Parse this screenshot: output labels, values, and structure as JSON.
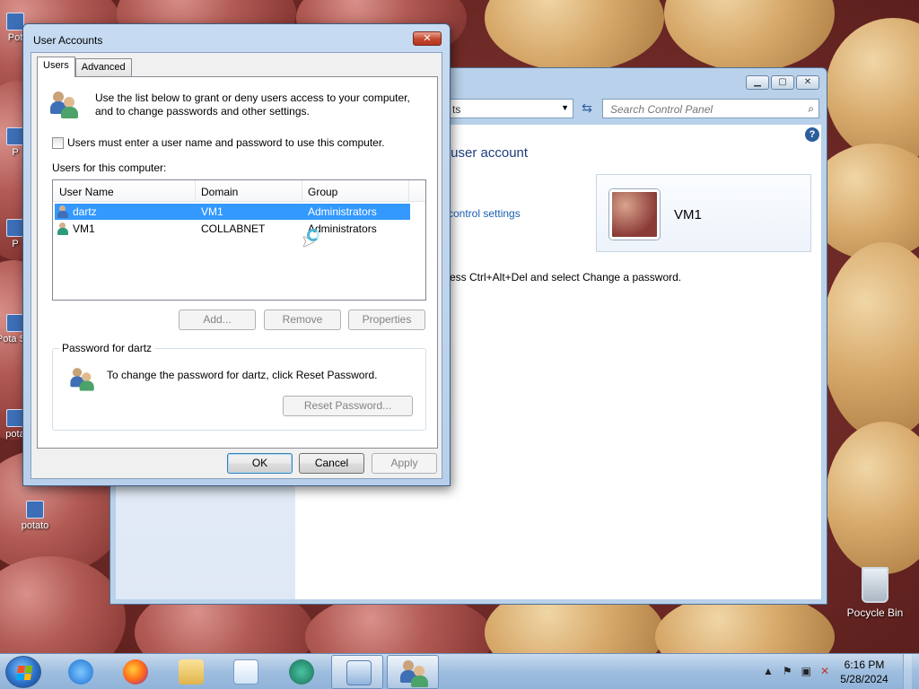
{
  "desktop": {
    "icons": [
      {
        "label": "Pot"
      },
      {
        "label": "P"
      },
      {
        "label": "P"
      },
      {
        "label": "Pota Stu"
      },
      {
        "label": "pota"
      },
      {
        "label": "potato"
      }
    ],
    "recycle_bin_label": "Pocycle Bin"
  },
  "control_panel": {
    "address_text": "ts",
    "search_placeholder": "Search Control Panel",
    "heading": "r user account",
    "link_text": "control settings",
    "instruction_text": "ress Ctrl+Alt+Del and select Change a password.",
    "user_name": "VM1",
    "help_label": "?"
  },
  "dialog": {
    "title": "User Accounts",
    "close_label": "✕",
    "tabs": [
      {
        "label": "Users",
        "active": true
      },
      {
        "label": "Advanced",
        "active": false
      }
    ],
    "intro": "Use the list below to grant or deny users access to your computer, and to change passwords and other settings.",
    "must_logon_label": "Users must enter a user name and password to use this computer.",
    "must_logon_checked": false,
    "users_section_label": "Users for this computer:",
    "columns": [
      "User Name",
      "Domain",
      "Group"
    ],
    "users": [
      {
        "name": "dartz",
        "domain": "VM1",
        "group": "Administrators",
        "selected": true
      },
      {
        "name": "VM1",
        "domain": "COLLABNET",
        "group": "Administrators",
        "selected": false
      }
    ],
    "buttons": {
      "add": "Add...",
      "remove": "Remove",
      "properties": "Properties",
      "reset_password": "Reset Password...",
      "ok": "OK",
      "cancel": "Cancel",
      "apply": "Apply"
    },
    "password_group_label": "Password for dartz",
    "password_text": "To change the password for dartz, click Reset Password."
  },
  "taskbar": {
    "time": "6:16 PM",
    "date": "5/28/2024",
    "apps": [
      "internet-explorer",
      "firefox",
      "file-explorer",
      "media-player",
      "app-icon",
      "control-panel",
      "user-accounts"
    ]
  },
  "colors": {
    "selection": "#3399ff",
    "link": "#1a5fb4",
    "heading": "#1e3d7c"
  }
}
